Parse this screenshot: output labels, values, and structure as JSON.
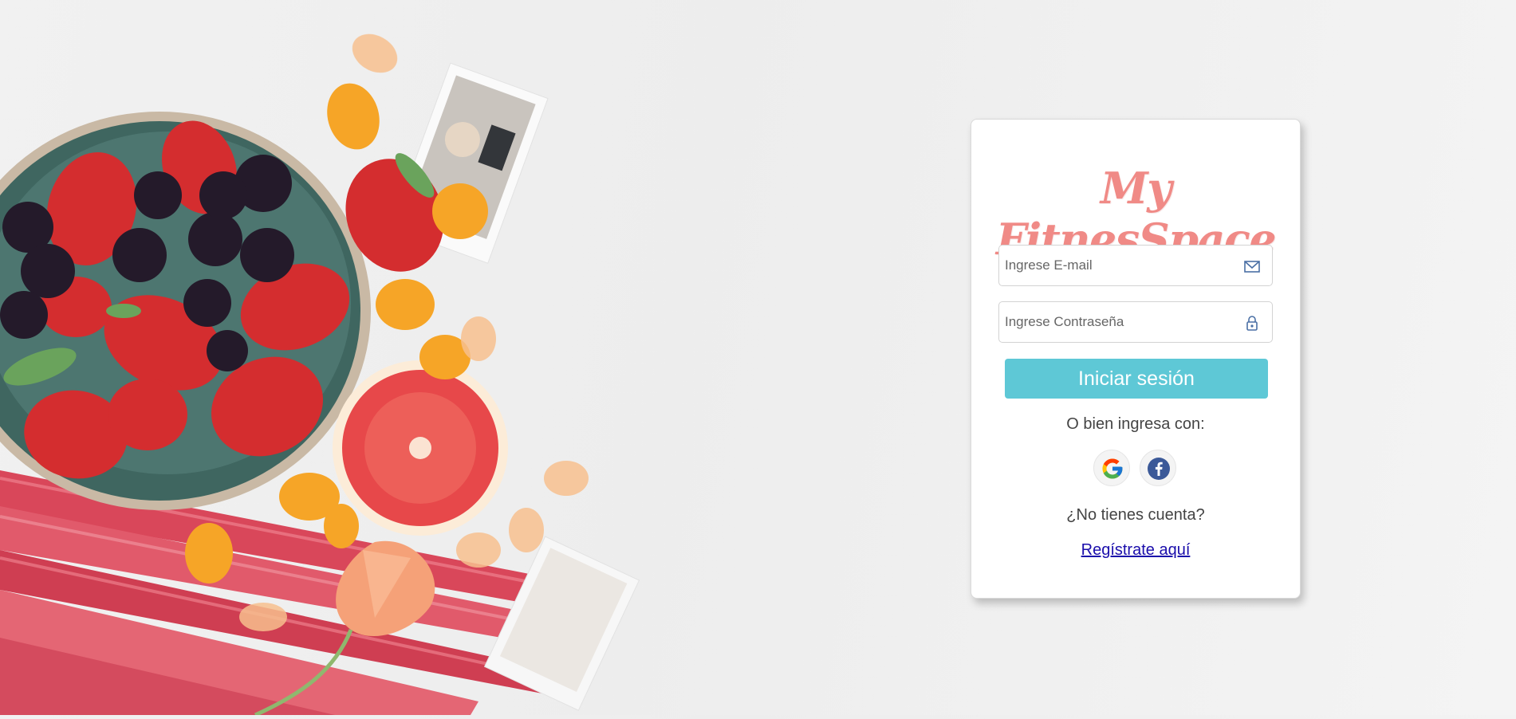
{
  "app": {
    "logo_text": "My FitnesSpace"
  },
  "login_form": {
    "email_placeholder": "Ingrese E-mail",
    "email_value": "",
    "password_placeholder": "Ingrese Contraseña",
    "password_value": "",
    "submit_label": "Iniciar sesión",
    "alt_login_label": "O bien ingresa con:",
    "social_providers": [
      "google",
      "facebook"
    ],
    "no_account_label": "¿No tienes cuenta?",
    "register_link_label": "Regístrate aquí"
  },
  "icons": {
    "email": "envelope-icon",
    "password": "padlock-icon",
    "google": "google-logo-icon",
    "facebook": "facebook-logo-icon"
  },
  "colors": {
    "logo": "#f08a86",
    "button": "#5ec8d6",
    "link": "#1a0dab",
    "facebook": "#3b5998"
  }
}
